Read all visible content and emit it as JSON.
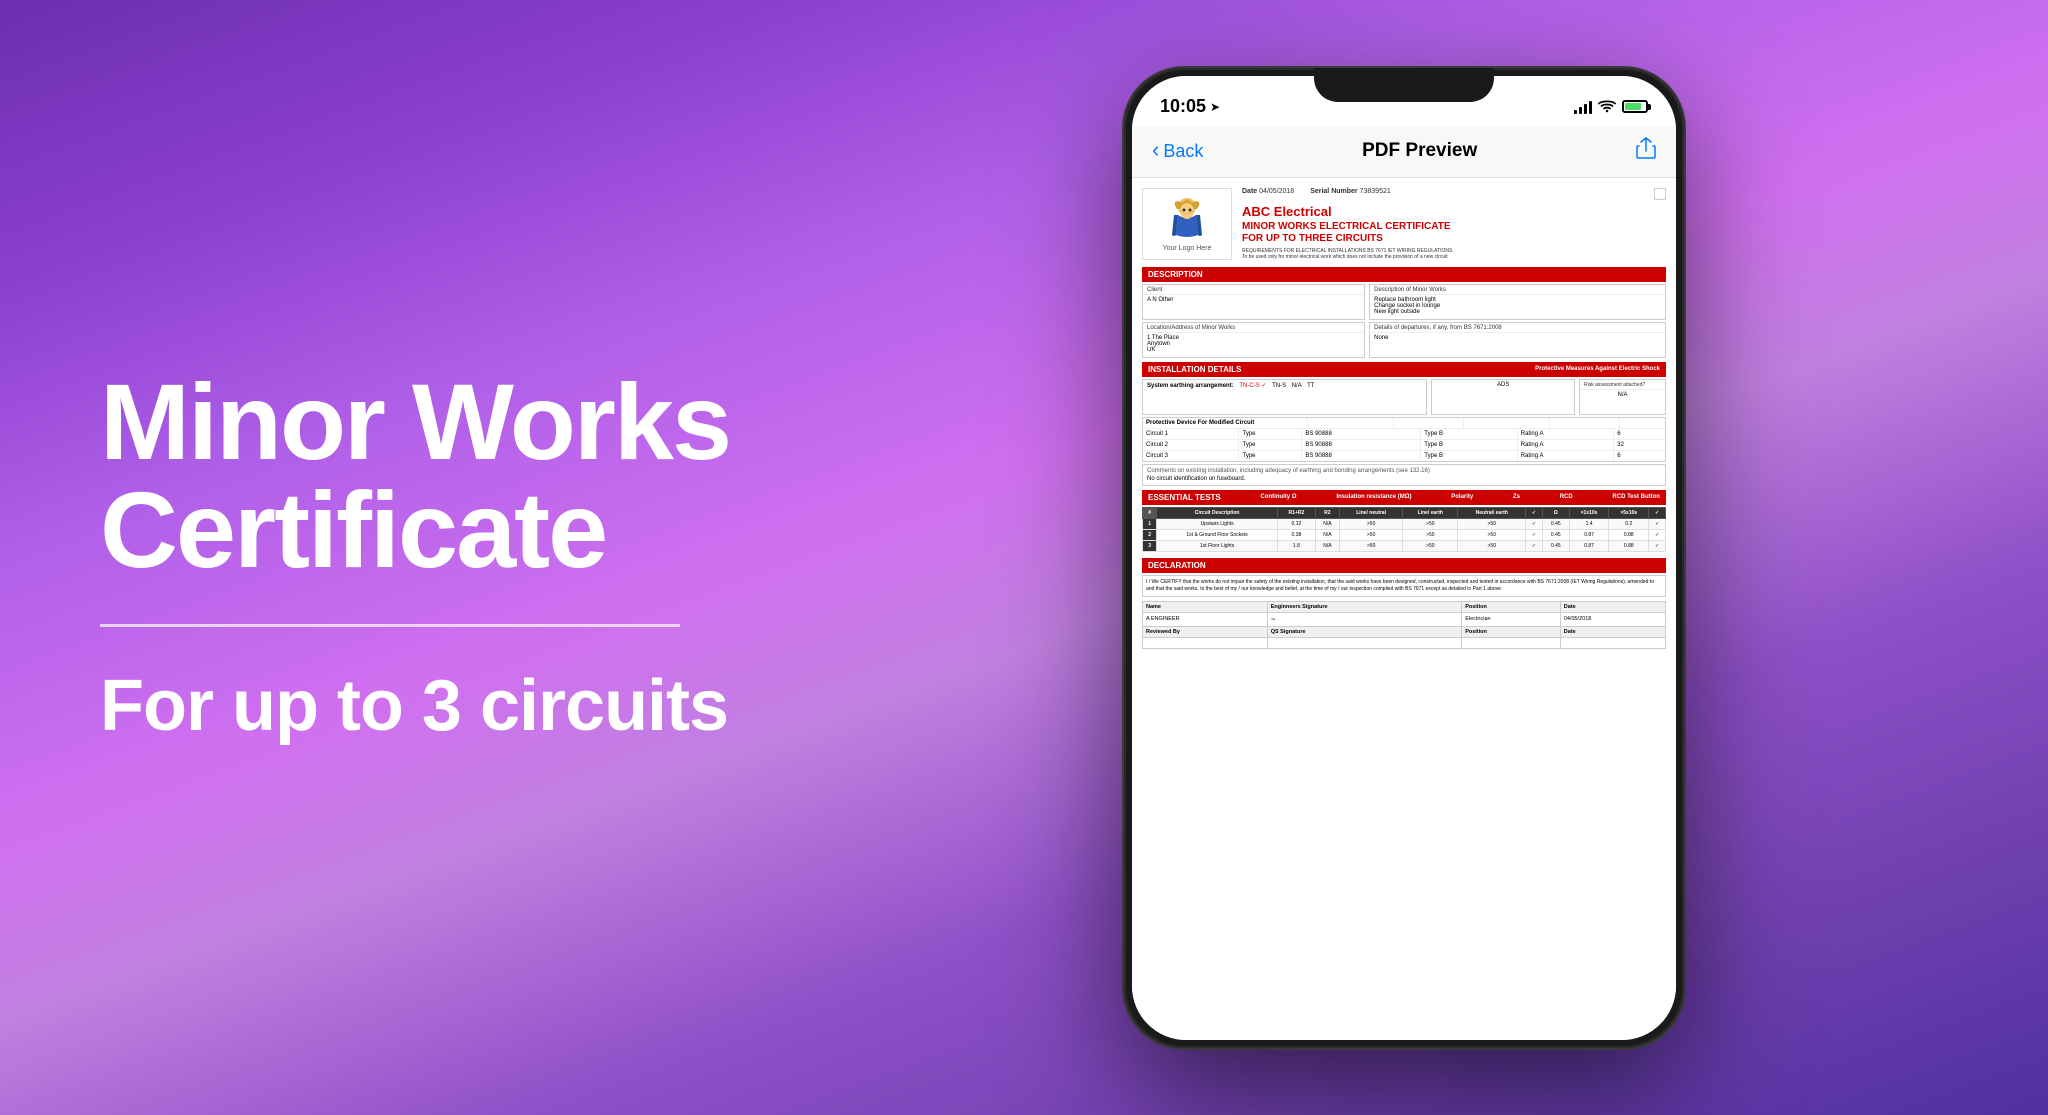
{
  "background": {
    "gradient_start": "#7B2FBE",
    "gradient_end": "#5030A0"
  },
  "left_panel": {
    "main_title": "Minor Works Certificate",
    "subtitle": "For up to 3 circuits"
  },
  "phone": {
    "status_bar": {
      "time": "10:05",
      "location_arrow": "›"
    },
    "nav": {
      "back_label": "Back",
      "title": "PDF Preview"
    },
    "certificate": {
      "logo_text": "Your Logo Here",
      "date_label": "Date",
      "date_value": "04/05/2018",
      "serial_label": "Serial Number",
      "serial_value": "73839521",
      "company_name": "ABC Electrical",
      "cert_title_line1": "MINOR WORKS ELECTRICAL CERTIFICATE",
      "cert_title_line2": "FOR UP TO THREE CIRCUITS",
      "cert_reg_text": "REQUIREMENTS FOR ELECTRICAL INSTALLATIONS BS 7671 IET WIRING REGULATIONS",
      "cert_reg_text2": "To be used only for minor electrical work which does not include the provision of a new circuit",
      "sections": {
        "description": {
          "header": "DESCRIPTION",
          "desc_label": "Description of Minor Works",
          "desc_values": [
            "Replace bathroom light",
            "Change socket in lounge",
            "New light outside"
          ],
          "client_label": "Client",
          "client_value": "A N Other",
          "location_label": "Location/Address of Minor Works",
          "location_values": [
            "1 The Place",
            "Anytown",
            "UK"
          ],
          "departures_label": "Details of departures, if any, from BS 7671:2008",
          "departures_value": "None"
        },
        "installation": {
          "header": "INSTALLATION DETAILS",
          "protective_header": "Protective Measures Against Electric Shock",
          "risk_header": "Risk assessment attached?",
          "risk_value": "N/A",
          "earthing_label": "System earthing arrangement:",
          "earthing_options": [
            {
              "label": "TN-C-S",
              "checked": true
            },
            {
              "label": "TN-S",
              "checked": false
            },
            {
              "label": "N/A",
              "checked": false
            },
            {
              "label": "TT",
              "checked": false
            }
          ],
          "ads_value": "ADS",
          "protective_device_label": "Protective Device For Modified Circuit",
          "circuits": [
            {
              "num": "Circuit 1",
              "type_label": "Type",
              "bs": "BS 90888",
              "type_val": "Type B",
              "rating_label": "Rating A",
              "rating_val": "6"
            },
            {
              "num": "Circuit 2",
              "type_label": "Type",
              "bs": "BS 90888",
              "type_val": "Type B",
              "rating_label": "Rating A",
              "rating_val": "32"
            },
            {
              "num": "Circuit 3",
              "type_label": "Type",
              "bs": "BS 90888",
              "type_val": "Type B",
              "rating_label": "Rating A",
              "rating_val": "6"
            }
          ],
          "comments_label": "Comments on existing installation, including adequacy of earthing and bonding arrangements (see 132.16)",
          "comments_value": "No circuit identification on fuseboard."
        },
        "essential_tests": {
          "header": "ESSENTIAL TESTS",
          "sub_headers": [
            "Continuity Ω (R1 + r2)",
            "Insulation resistance (MΩ)",
            "Polarity",
            "Zs",
            "RCD",
            "RCD Test Button"
          ],
          "table_headers": [
            "Circuit Description",
            "R1 + R2",
            "R2",
            "Line / neutral",
            "Line / earth",
            "Neutral / earth",
            "✓",
            "Ω",
            "× 1x10s",
            "× 5x10s",
            "✓"
          ],
          "rows": [
            {
              "num": "1",
              "desc": "Upstairs Lights",
              "r1r2": "0.12",
              "r2": "N/A",
              "ln": ">50",
              "le": ">50",
              "ne": ">50",
              "pol": "✓",
              "zs": "0.45",
              "rcd1": "1.4",
              "rcd2": "0.2",
              "btn": "✓"
            },
            {
              "num": "2",
              "desc": "1st & Ground Floor Sockets",
              "r1r2": "0.38",
              "r2": "N/A",
              "ln": ">50",
              "le": ">50",
              "ne": ">50",
              "pol": "✓",
              "zs": "0.45",
              "rcd1": "0.87",
              "rcd2": "0.88",
              "btn": "✓"
            },
            {
              "num": "3",
              "desc": "1st Floor Lights",
              "r1r2": "1.8",
              "r2": "N/A",
              "ln": ">50",
              "le": ">50",
              "ne": ">50",
              "pol": "✓",
              "zs": "0.45",
              "rcd1": "0.87",
              "rcd2": "0.88",
              "btn": "✓"
            }
          ]
        },
        "declaration": {
          "header": "DECLARATION",
          "text": "I / We CERTIFY that the works do not impair the safety of the existing installation, that the said works have been designed, constructed, inspected and tested in accordance with BS 7671:2008 (IET Wiring Regulations), amended to                  and that the said works, to the best of my / our knowledge and belief, at the time of my / our inspection complied with BS 7671 except as detailed in Part 1 above.",
          "sig_rows": [
            {
              "name": "A ENGINEER",
              "sig": "~",
              "position": "Electrician",
              "date": "04/05/2018"
            },
            {
              "name": "Reviewed By",
              "sig": "",
              "position": "QS Signature",
              "date": ""
            }
          ]
        }
      }
    }
  }
}
